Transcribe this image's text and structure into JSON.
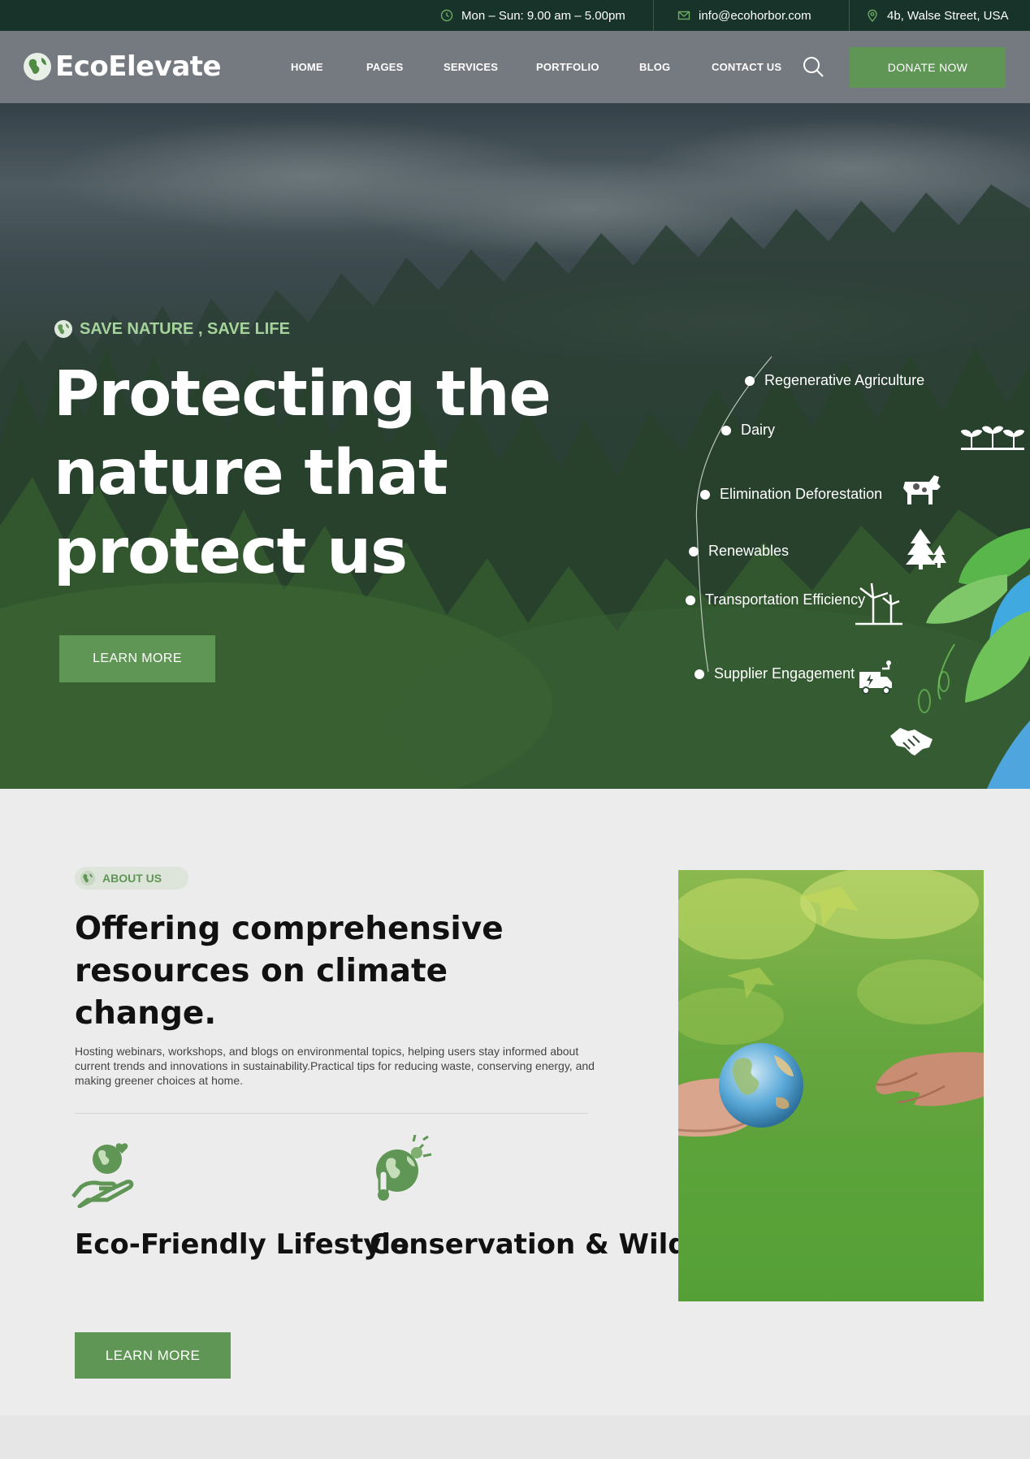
{
  "topbar": {
    "hours": "Mon – Sun: 9.00 am – 5.00pm",
    "email": "info@ecohorbor.com",
    "address": "4b, Walse Street, USA"
  },
  "nav": {
    "logo": "EcoElevate",
    "links": [
      "HOME",
      "PAGES",
      "SERVICES",
      "PORTFOLIO",
      "BLOG",
      "CONTACT US"
    ],
    "donate": "DONATE NOW"
  },
  "hero": {
    "eyebrow": "SAVE NATURE , SAVE LIFE",
    "title": "Protecting the nature that protect us",
    "cta": "LEARN MORE",
    "features": [
      {
        "label": "Regenerative Agriculture",
        "icon": "sprouts-icon"
      },
      {
        "label": "Dairy",
        "icon": "cow-icon"
      },
      {
        "label": "Elimination Deforestation",
        "icon": "pine-trees-icon"
      },
      {
        "label": "Renewables",
        "icon": "wind-turbine-icon"
      },
      {
        "label": "Transportation Efficiency",
        "icon": "electric-truck-icon"
      },
      {
        "label": "Supplier Engagement",
        "icon": "handshake-icon"
      }
    ]
  },
  "about": {
    "badge": "ABOUT US",
    "title": "Offering comprehensive resources on climate change.",
    "description": "Hosting webinars, workshops, and blogs on environmental topics, helping users stay informed about current trends and innovations in sustainability.Practical tips for reducing waste, conserving energy, and making greener choices at home.",
    "cards": [
      {
        "title": "Eco-Friendly Lifestyle",
        "icon": "globe-in-hand-icon"
      },
      {
        "title": "Conservation & Wildlife",
        "icon": "globe-thermometer-icon"
      }
    ],
    "cta": "LEARN MORE"
  },
  "colors": {
    "accent": "#5f9555",
    "topbar": "#17332a",
    "eyebrow": "#a5d49a"
  }
}
